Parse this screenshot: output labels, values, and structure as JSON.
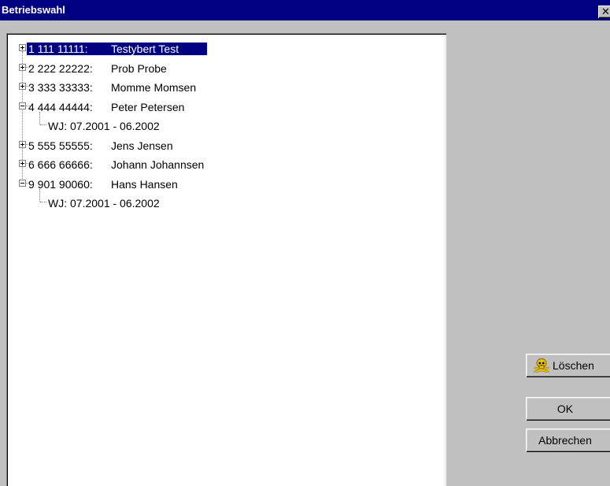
{
  "window": {
    "title": "Betriebswahl",
    "close_glyph": "✕"
  },
  "tree": {
    "nodes": [
      {
        "id": "1 111 11111:",
        "name": "Testybert Test",
        "expanded": false,
        "selected": true
      },
      {
        "id": "2 222 22222:",
        "name": "Prob Probe",
        "expanded": false,
        "selected": false
      },
      {
        "id": "3 333 33333:",
        "name": "Momme Momsen",
        "expanded": false,
        "selected": false
      },
      {
        "id": "4 444 44444:",
        "name": "Peter Petersen",
        "expanded": true,
        "selected": false,
        "children": [
          "WJ: 07.2001 - 06.2002"
        ]
      },
      {
        "id": "5 555 55555:",
        "name": "Jens Jensen",
        "expanded": false,
        "selected": false
      },
      {
        "id": "6 666 66666:",
        "name": "Johann Johannsen",
        "expanded": false,
        "selected": false
      },
      {
        "id": "9 901 90060:",
        "name": "Hans Hansen",
        "expanded": true,
        "selected": false,
        "children": [
          "WJ: 07.2001 - 06.2002"
        ]
      }
    ]
  },
  "buttons": {
    "delete_label": "Löschen",
    "delete_icon": "skull-crossbones-icon",
    "ok_label": "OK",
    "cancel_label": "Abbrechen"
  },
  "colors": {
    "titlebar": "#000080",
    "selection": "#000080",
    "face": "#c0c0c0",
    "icon_yellow": "#e8c800"
  }
}
